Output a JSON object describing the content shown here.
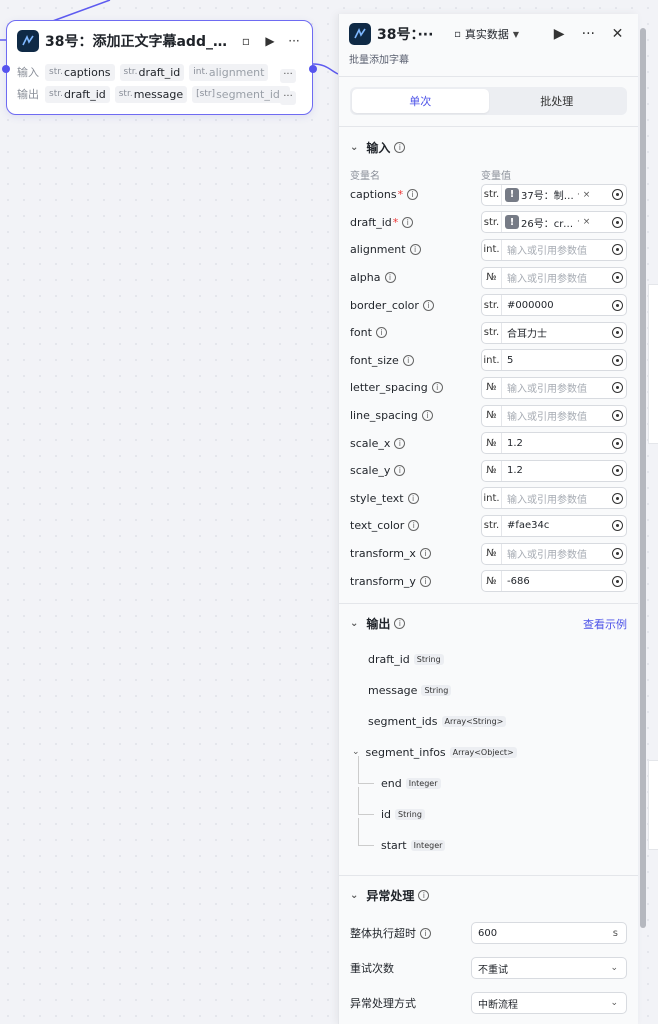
{
  "node": {
    "title": "38号：添加正文字幕add_cap···",
    "input_label": "输入",
    "output_label": "输出",
    "inputs": [
      {
        "type": "str.",
        "name": "captions"
      },
      {
        "type": "str.",
        "name": "draft_id"
      },
      {
        "type": "int.",
        "name": "alignment"
      }
    ],
    "outputs": [
      {
        "type": "str.",
        "name": "draft_id"
      },
      {
        "type": "str.",
        "name": "message"
      },
      {
        "type": "[str]",
        "name": "segment_ids"
      }
    ],
    "more": "···"
  },
  "panel": {
    "title": "38号：···",
    "mode": "真实数据",
    "subtitle": "批量添加字幕",
    "tabs": [
      "单次",
      "批处理"
    ],
    "input_section": {
      "title": "输入",
      "col_name": "变量名",
      "col_value": "变量值",
      "params": [
        {
          "name": "captions",
          "required": "*",
          "type": "str.",
          "ref": "37号：制作···",
          "ref_suffix": "· ×"
        },
        {
          "name": "draft_id",
          "required": "*",
          "type": "str.",
          "ref": "26号：crea···",
          "ref_suffix": "· ×"
        },
        {
          "name": "alignment",
          "type": "int.",
          "placeholder": "输入或引用参数值"
        },
        {
          "name": "alpha",
          "type": "№",
          "placeholder": "输入或引用参数值"
        },
        {
          "name": "border_color",
          "type": "str.",
          "value": "#000000"
        },
        {
          "name": "font",
          "type": "str.",
          "value": "合耳力士"
        },
        {
          "name": "font_size",
          "type": "int.",
          "value": "5"
        },
        {
          "name": "letter_spacing",
          "type": "№",
          "placeholder": "输入或引用参数值"
        },
        {
          "name": "line_spacing",
          "type": "№",
          "placeholder": "输入或引用参数值"
        },
        {
          "name": "scale_x",
          "type": "№",
          "value": "1.2"
        },
        {
          "name": "scale_y",
          "type": "№",
          "value": "1.2"
        },
        {
          "name": "style_text",
          "type": "int.",
          "placeholder": "输入或引用参数值"
        },
        {
          "name": "text_color",
          "type": "str.",
          "value": "#fae34c"
        },
        {
          "name": "transform_x",
          "type": "№",
          "placeholder": "输入或引用参数值"
        },
        {
          "name": "transform_y",
          "type": "№",
          "value": "-686"
        }
      ]
    },
    "output_section": {
      "title": "输出",
      "link": "查看示例",
      "items": [
        {
          "name": "draft_id",
          "type": "String"
        },
        {
          "name": "message",
          "type": "String"
        },
        {
          "name": "segment_ids",
          "type": "Array<String>"
        },
        {
          "name": "segment_infos",
          "type": "Array<Object>"
        },
        {
          "name": "end",
          "type": "Integer"
        },
        {
          "name": "id",
          "type": "String"
        },
        {
          "name": "start",
          "type": "Integer"
        }
      ]
    },
    "exception_section": {
      "title": "异常处理",
      "timeout_label": "整体执行超时",
      "timeout_value": "600",
      "timeout_unit": "s",
      "retry_label": "重试次数",
      "retry_value": "不重试",
      "method_label": "异常处理方式",
      "method_value": "中断流程"
    }
  },
  "colors": {
    "accent": "#4d53e8",
    "node_border": "#6e6bf2",
    "required": "#ee3333"
  }
}
